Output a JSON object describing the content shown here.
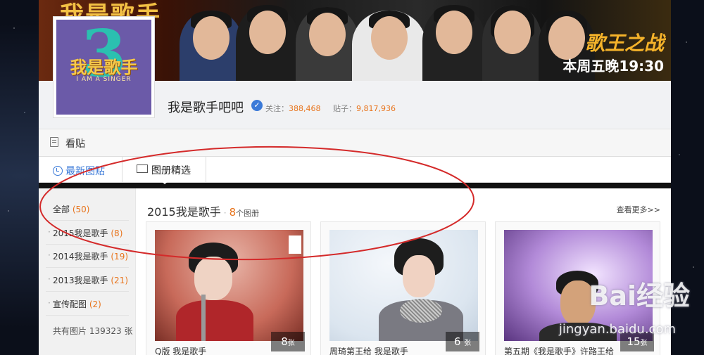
{
  "banner": {
    "title": "我是歌手",
    "tagline": "歌王之战",
    "showtime": "本周五晚19:30"
  },
  "logo": {
    "numeral": "3",
    "text": "我是歌手",
    "subtext": "I AM A SINGER"
  },
  "forum": {
    "name": "我是歌手吧吧",
    "follow_label": "关注：",
    "follow_count": "388,468",
    "posts_label": "贴子：",
    "posts_count": "9,817,936"
  },
  "readbar": {
    "label": "看贴"
  },
  "tabs": [
    {
      "label": "最新图贴"
    },
    {
      "label": "图册精选"
    }
  ],
  "sidebar": {
    "items": [
      {
        "label": "全部",
        "count": "(50)"
      },
      {
        "label": "2015我是歌手",
        "count": "(8)"
      },
      {
        "label": "2014我是歌手",
        "count": "(19)"
      },
      {
        "label": "2013我是歌手",
        "count": "(21)"
      },
      {
        "label": "宣传配图",
        "count": "(2)"
      }
    ],
    "total": "共有图片 139323 张"
  },
  "section": {
    "title": "2015我是歌手",
    "sep": "·",
    "count": "8",
    "unit": "个图册",
    "more": "查看更多>>"
  },
  "albums": [
    {
      "count": "8",
      "unit": "张",
      "caption": "Q版 我是歌手"
    },
    {
      "count": "6",
      "unit": "张",
      "caption": "周琦第王给 我是歌手"
    },
    {
      "count": "15",
      "unit": "张",
      "caption": "第五期《我是歌手》许路王给"
    }
  ],
  "watermark": {
    "brand": "Bai经验",
    "domain": "jingyan.baidu.com"
  },
  "colors": {
    "accent_orange": "#e8741c",
    "link_blue": "#3b7ad8",
    "annotation_red": "#d42a2a"
  }
}
